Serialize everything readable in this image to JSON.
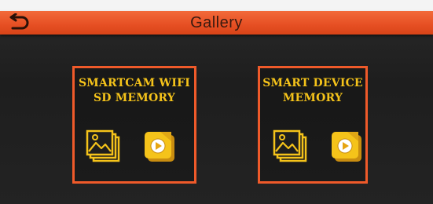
{
  "header": {
    "title": "Gallery",
    "back_icon": "back-arrow-icon",
    "accent_color": "#e64f23"
  },
  "panels": [
    {
      "title": "SMARTCAM WIFI\nSD MEMORY",
      "icons": [
        "photo-gallery-icon",
        "video-gallery-icon"
      ]
    },
    {
      "title": "SMART DEVICE\nMEMORY",
      "icons": [
        "photo-gallery-icon",
        "video-gallery-icon"
      ]
    }
  ],
  "colors": {
    "panel_border": "#ef5a2a",
    "title_text": "#f5c31a",
    "icon_yellow": "#f5c31a"
  }
}
